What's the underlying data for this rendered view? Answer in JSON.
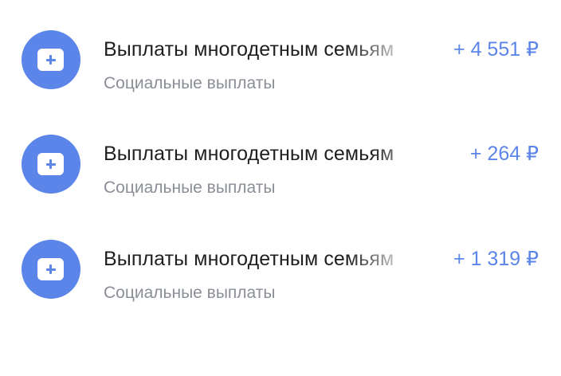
{
  "colors": {
    "accent": "#5b85e9",
    "title_text": "#1f1f1f",
    "subtitle_text": "#8a8e96",
    "background": "#ffffff"
  },
  "transactions": [
    {
      "icon": "plus-square-icon",
      "title": "Выплаты многодетным семьям",
      "subtitle": "Социальные выплаты",
      "amount": "+ 4 551 ₽"
    },
    {
      "icon": "plus-square-icon",
      "title": "Выплаты многодетным семьям",
      "subtitle": "Социальные выплаты",
      "amount": "+ 264 ₽"
    },
    {
      "icon": "plus-square-icon",
      "title": "Выплаты многодетным семьям",
      "subtitle": "Социальные выплаты",
      "amount": "+ 1 319 ₽"
    }
  ]
}
